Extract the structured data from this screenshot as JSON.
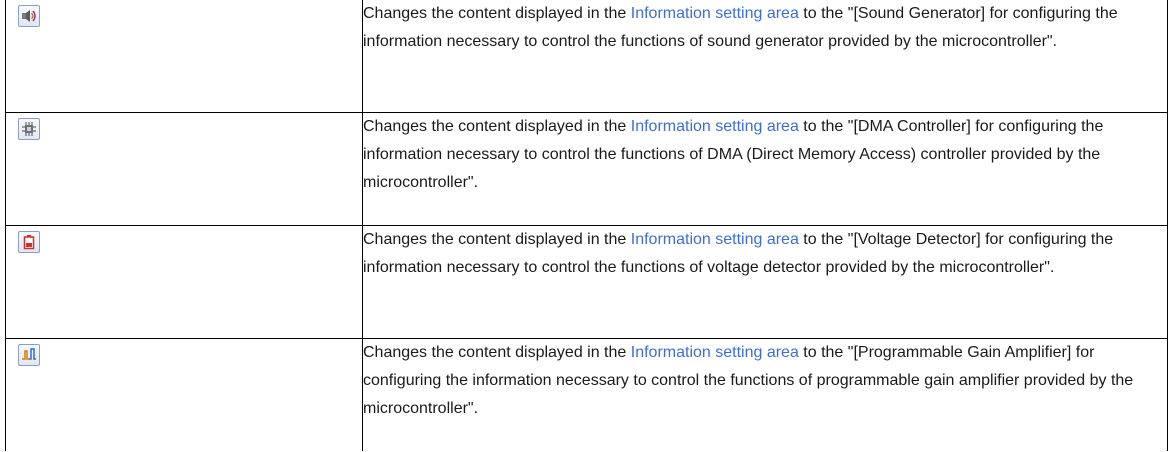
{
  "rows": [
    {
      "icon": "sound-generator-icon",
      "parts": [
        "Changes the content displayed in the ",
        "Information setting area",
        " to the \"[Sound Generator] for configuring the information necessary to control the functions of sound generator provided by the microcontroller\"."
      ]
    },
    {
      "icon": "dma-controller-icon",
      "parts": [
        "Changes the content displayed in the ",
        "Information setting area",
        " to the \"[DMA Controller] for configuring the information necessary to control the functions of DMA (Direct Memory Access) controller provided by the microcontroller\"."
      ]
    },
    {
      "icon": "voltage-detector-icon",
      "parts": [
        "Changes the content displayed in the ",
        "Information setting area",
        " to the \"[Voltage Detector] for configuring the information necessary to control the functions of voltage detector provided by the microcontroller\"."
      ]
    },
    {
      "icon": "programmable-gain-amplifier-icon",
      "parts": [
        "Changes the content displayed in the ",
        "Information setting area",
        " to the \"[Programmable Gain Amplifier] for configuring the information necessary to control the functions of programmable gain amplifier provided by the microcontroller\"."
      ]
    }
  ]
}
